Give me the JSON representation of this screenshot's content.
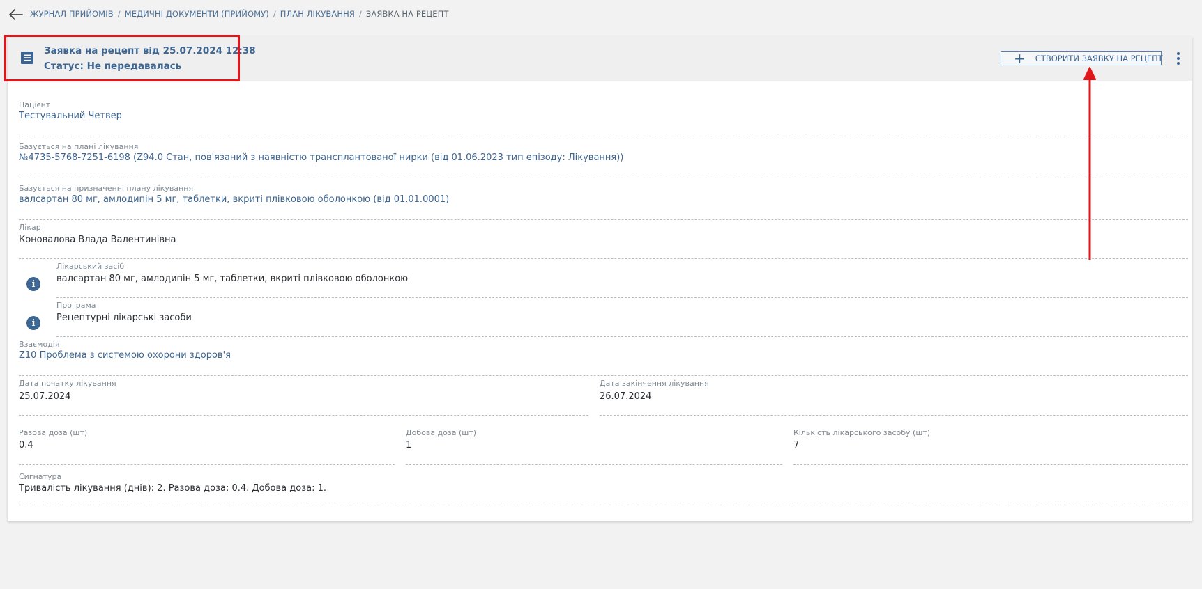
{
  "breadcrumb": {
    "items": [
      "ЖУРНАЛ ПРИЙОМІВ",
      "МЕДИЧНІ ДОКУМЕНТИ (ПРИЙОМУ)",
      "ПЛАН ЛІКУВАННЯ"
    ],
    "current": "ЗАЯВКА НА РЕЦЕПТ",
    "separator": "/"
  },
  "header": {
    "title": "Заявка на рецепт від 25.07.2024 12:38",
    "status": "Статус: Не передавалась",
    "create_button_label": "СТВОРИТИ ЗАЯВКУ НА РЕЦЕПТ",
    "icon": "document-list-icon"
  },
  "fields": {
    "patient": {
      "label": "Пацієнт",
      "value": "Тестувальний Четвер"
    },
    "plan": {
      "label": "Базується на плані лікування",
      "value": "№4735-5768-7251-6198 (Z94.0 Стан, пов'язаний з наявністю трансплантованої нирки (від 01.06.2023 тип епізоду: Лікування))"
    },
    "prescription": {
      "label": "Базується на призначенні плану лікування",
      "value": "валсартан 80 мг, амлодипін 5 мг, таблетки, вкриті плівковою оболонкою (від 01.01.0001)"
    },
    "doctor": {
      "label": "Лікар",
      "value": "Коновалова Влада Валентинівна"
    },
    "medicine": {
      "label": "Лікарський засіб",
      "value": "валсартан 80 мг, амлодипін 5 мг, таблетки, вкриті плівковою оболонкою"
    },
    "program": {
      "label": "Програма",
      "value": "Рецептурні лікарські засоби"
    },
    "interaction": {
      "label": "Взаємодія",
      "value": "Z10 Проблема з системою охорони здоров'я"
    },
    "start_date": {
      "label": "Дата початку лікування",
      "value": "25.07.2024"
    },
    "end_date": {
      "label": "Дата закінчення лікування",
      "value": "26.07.2024"
    },
    "single_dose": {
      "label": "Разова доза (шт)",
      "value": "0.4"
    },
    "daily_dose": {
      "label": "Добова доза (шт)",
      "value": "1"
    },
    "quantity": {
      "label": "Кількість лікарського засобу (шт)",
      "value": "7"
    },
    "signature": {
      "label": "Сигнатура",
      "value": "Тривалість лікування (днів): 2. Разова доза: 0.4. Добова доза: 1."
    }
  },
  "colors": {
    "accent": "#3d6591",
    "annotation": "#e0161a",
    "background": "#f2f2f2"
  }
}
